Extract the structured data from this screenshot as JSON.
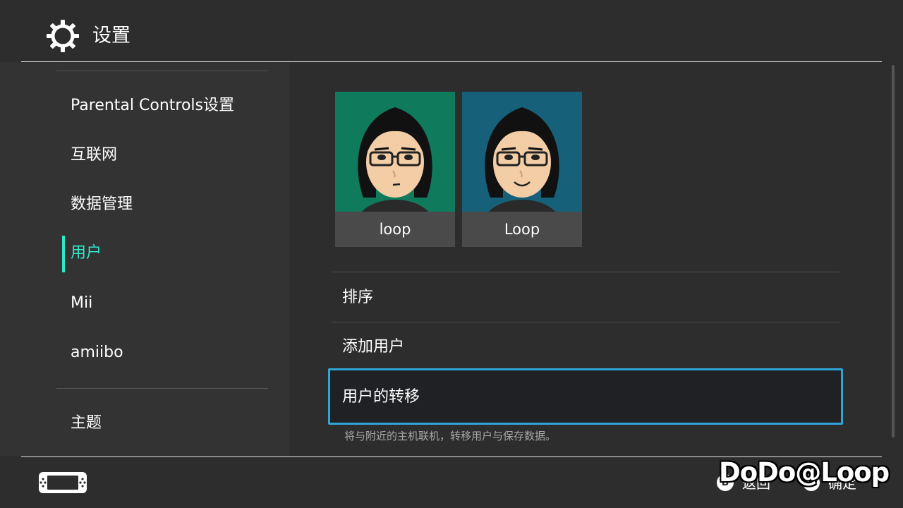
{
  "header": {
    "title": "设置",
    "icon": "gear-icon"
  },
  "sidebar": {
    "items": [
      {
        "label": "Parental Controls设置"
      },
      {
        "label": "互联网"
      },
      {
        "label": "数据管理"
      },
      {
        "label": "用户",
        "active": true
      },
      {
        "label": "Mii"
      },
      {
        "label": "amiibo"
      },
      {
        "label": "主题"
      }
    ],
    "accent_color": "#2fe8c8"
  },
  "users": [
    {
      "name": "loop",
      "background": "#0f7a5c"
    },
    {
      "name": "Loop",
      "background": "#17607a"
    }
  ],
  "menu": {
    "items": [
      {
        "label": "排序"
      },
      {
        "label": "添加用户"
      }
    ],
    "selected": {
      "label": "用户的转移",
      "description": "将与附近的主机联机，转移用户与保存数据。"
    },
    "selection_color": "#2ea6d8"
  },
  "footer": {
    "back": {
      "button": "B",
      "label": "返回"
    },
    "confirm": {
      "button": "A",
      "label": "确定"
    },
    "console_icon": "switch-console-icon"
  },
  "watermark": "DoDo@Loop"
}
